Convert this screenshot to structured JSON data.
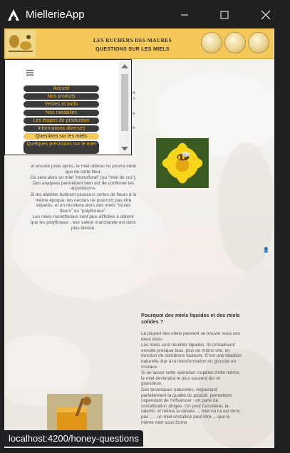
{
  "window": {
    "title": "MiellerieApp",
    "icon": "app-logo-icon"
  },
  "banner": {
    "title": "LES RUCHERS DES MAURES",
    "subtitle": "QUESTIONS SUR LES MIELS",
    "brand_color": "#f4c95a"
  },
  "nav": {
    "menu_icon": "hamburger-icon",
    "items": [
      {
        "label": "Accueil"
      },
      {
        "label": "Nos produits"
      },
      {
        "label": "Ventes et tarifs"
      },
      {
        "label": "Nos médailles"
      },
      {
        "label": "Les étapes de production"
      },
      {
        "label": "Informations diverses"
      },
      {
        "label": "Questions sur les miels",
        "active": true
      },
      {
        "label": "Quelques précisions sur le miel"
      }
    ],
    "item_color": "#3a3a3a",
    "text_color": "#f0b62e",
    "active_color": "#f4c95a"
  },
  "section1": {
    "fragments": [
      "e",
      "?",
      "e",
      "e"
    ],
    "paragraphs": [
      "et ensuite juste après, le miel obtenu ne pourra venir que de cette fleur.",
      "Ce sera alors un miel \"monofloral\" (ou \"miel de cru\"). Des analyses permettent bien sûr de confirmer les appellations.",
      "Si les abeilles butinent plusieurs sortes de fleurs à la même époque, les nectars ne pourront pas être séparés, et on récoltera alors des miels \"toutes fleurs\" ou \"polyfloraux\".",
      "Les miels monofloraux sont plus difficiles à obtenir que les polyfloraux : leur valeur marchande est donc plus élevée."
    ]
  },
  "section2": {
    "title": "Pourquoi des miels liquides et des miels solides ?",
    "paragraphs": [
      "La plupart des miels peuvent se trouver sous ces deux états.",
      "Les miels sont récoltés liquides. Ils cristallisent ensuite presque tous, plus ou moins vite, en fonction de nombreux facteurs. C'est une réaction naturelle due à la transformation du glucose en cristaux.",
      "Si on laisse cette opération s'opérer d'elle même, le miel deviendra le plus souvent dur et granuleux.",
      "Des techniques naturelles, respectant parfaitement la qualité du produit, permettent cependant de l'influencer : on parle de cristallisation dirigée. On peut l'accélérer, la ralentir, et même la défaire ... miel ne lui est donc pas ... ; un miel cristallisé peut être ... que le même miel sous forme"
    ]
  },
  "status_bar": {
    "url": "localhost:4200/honey-questions"
  }
}
